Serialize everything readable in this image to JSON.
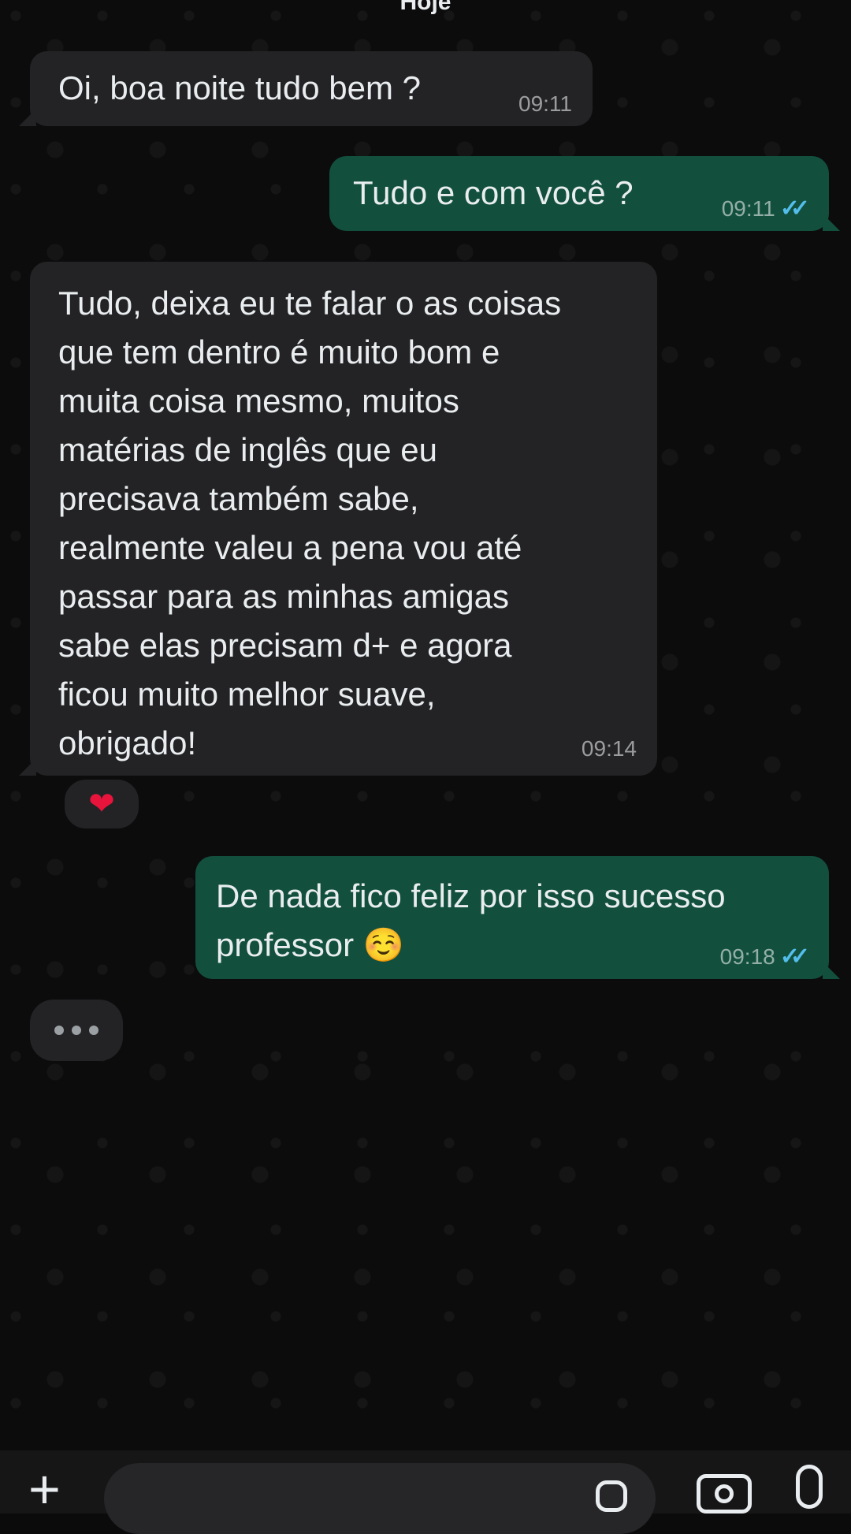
{
  "date_divider": "Hoje",
  "messages": [
    {
      "text": "Oi, boa noite tudo bem ?",
      "time": "09:11"
    },
    {
      "text": "Tudo e com você ?",
      "time": "09:11"
    },
    {
      "text": "Tudo, deixa eu te falar o as coisas\nque tem dentro  é muito bom e\nmuita coisa mesmo, muitos\nmatérias de inglês que eu\nprecisava também sabe,\nrealmente valeu a pena vou até\npassar para as minhas amigas\nsabe elas precisam d+ e agora\nficou muito melhor suave,\nobrigado!",
      "time": "09:14"
    },
    {
      "text": "De nada fico feliz por isso sucesso\nprofessor ☺️",
      "time": "09:18"
    }
  ],
  "reaction": "❤",
  "read_ticks": "✓✓",
  "colors": {
    "incoming": "#232325",
    "outgoing": "#12503d",
    "ticks": "#53bdeb"
  },
  "icons": [
    "plus-icon",
    "sticker-icon",
    "camera-icon",
    "microphone-icon"
  ]
}
